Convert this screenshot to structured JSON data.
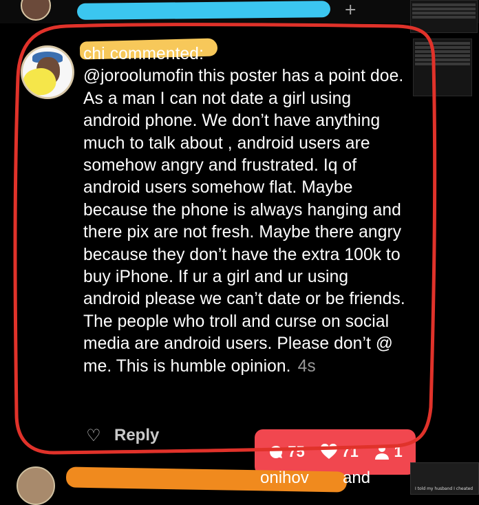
{
  "comment": {
    "author_visible": "chi",
    "verb": "commented:",
    "body": "@joroolumofin this poster has a point doe. As a man I can not date a girl using android phone. We don’t have anything much to talk about , android users are somehow angry and frustrated. Iq of android users somehow flat. Maybe because the phone is always hanging and there pix are not fresh. Maybe there angry because they don’t have the extra 100k to buy iPhone. If ur a girl and ur using android please we can’t date or be friends. The people who troll and curse on social media are android users. Please don’t @ me. This is humble opinion.",
    "time": "4s"
  },
  "actions": {
    "reply_label": "Reply"
  },
  "stats": {
    "comments": "75",
    "likes": "71",
    "followers": "1"
  },
  "bottom": {
    "name_fragment": "onihov",
    "trailing_text": "and"
  },
  "thumbs": {
    "bottom_right_caption": "I told my husband I cheated"
  },
  "colors": {
    "annotation_circle": "#e0322a",
    "stats_badge": "#f1474f",
    "redaction_top": "#3bc6f0",
    "redaction_name": "#f7c85a",
    "redaction_bottom": "#f08a1e"
  }
}
